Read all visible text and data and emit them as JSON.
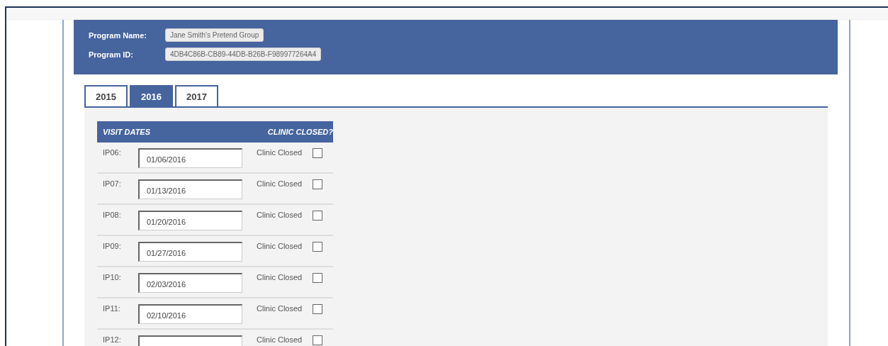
{
  "program": {
    "name_label": "Program Name:",
    "name_value": "Jane Smith's Pretend Group",
    "id_label": "Program ID:",
    "id_value": "4DB4C86B-CB89-44DB-B26B-F989977264A4"
  },
  "tabs": [
    {
      "label": "2015",
      "selected": false
    },
    {
      "label": "2016",
      "selected": true
    },
    {
      "label": "2017",
      "selected": false
    }
  ],
  "table": {
    "columns": [
      "VISIT DATES",
      "CLINIC CLOSED?"
    ],
    "rows": [
      {
        "label": "IP06:",
        "date": "01/06/2016",
        "closed_label": "Clinic Closed",
        "checked": false
      },
      {
        "label": "IP07:",
        "date": "01/13/2016",
        "closed_label": "Clinic Closed",
        "checked": false
      },
      {
        "label": "IP08:",
        "date": "01/20/2016",
        "closed_label": "Clinic Closed",
        "checked": false
      },
      {
        "label": "IP09:",
        "date": "01/27/2016",
        "closed_label": "Clinic Closed",
        "checked": false
      },
      {
        "label": "IP10:",
        "date": "02/03/2016",
        "closed_label": "Clinic Closed",
        "checked": false
      },
      {
        "label": "IP11:",
        "date": "02/10/2016",
        "closed_label": "Clinic Closed",
        "checked": false
      },
      {
        "label": "IP12:",
        "closed_label": "Clinic Closed",
        "checked": false
      }
    ]
  }
}
